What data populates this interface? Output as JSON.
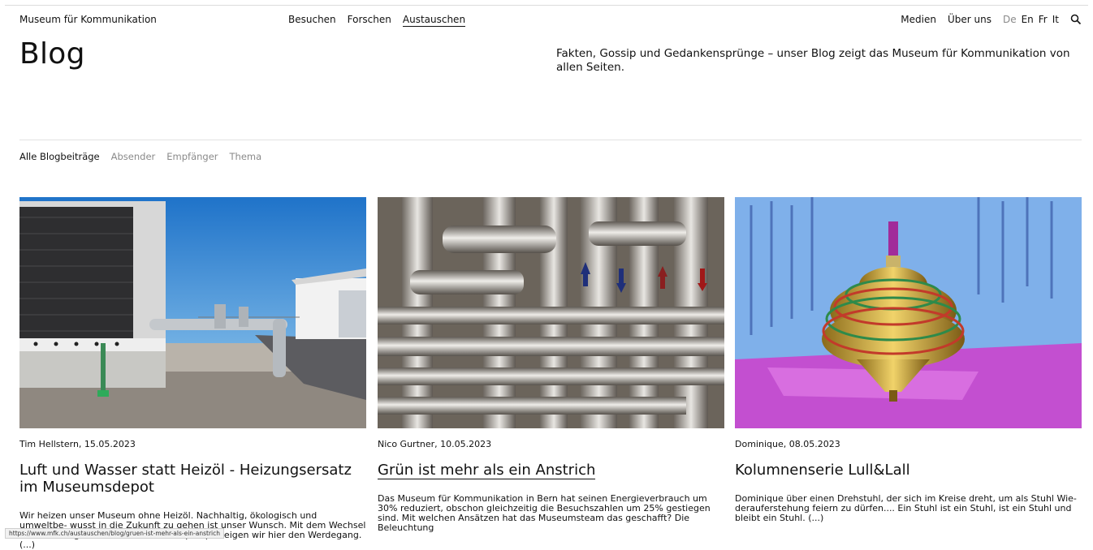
{
  "header": {
    "brand": "Museum für Kommunikation",
    "nav": [
      {
        "label": "Besuchen"
      },
      {
        "label": "Forschen"
      },
      {
        "label": "Austauschen"
      }
    ],
    "meta": {
      "medien": "Medien",
      "ueber_uns": "Über uns",
      "languages": [
        "De",
        "En",
        "Fr",
        "It"
      ],
      "search_icon": "search-icon"
    }
  },
  "page": {
    "title": "Blog",
    "intro": "Fakten, Gossip und Gedankensprünge – unser Blog zeigt das Museum für Kommunikation von allen Seiten."
  },
  "filters": [
    "Alle Blogbeiträge",
    "Absender",
    "Empfänger",
    "Thema"
  ],
  "posts": [
    {
      "byline": "Tim Hellstern, 15.05.2023",
      "title": "Luft und Wasser statt Heizöl - Heizungsersatz im Museumsdepot",
      "excerpt": "Wir heizen unser Museum ohne Heizöl. Nachhaltig, ökologisch und umweltbe- wusst in die Zukunft zu gehen ist unser Wunsch. Mit dem Wechsel der Hei- zung auf Luft-Wasser-Wärmepumpe zeigen wir hier den Werdegang. (...)"
    },
    {
      "byline": "Nico Gurtner, 10.05.2023",
      "title": "Grün ist mehr als ein Anstrich",
      "excerpt": "Das Museum für Kommunikation in Bern hat seinen Energieverbrauch um 30% reduziert, obschon gleichzeitig die Besuchszahlen um 25% gestiegen sind. Mit welchen Ansätzen hat das Museumsteam das geschafft? Die Beleuchtung"
    },
    {
      "byline": "Dominique, 08.05.2023",
      "title": "Kolumnenserie Lull&Lall",
      "excerpt": "Dominique über einen Drehstuhl, der sich im Kreise dreht, um als Stuhl Wie- derauferstehung feiern zu dürfen.... Ein Stuhl ist ein Stuhl, ist ein Stuhl und bleibt ein Stuhl. (...)"
    }
  ],
  "status_bar": {
    "url": "https://www.mfk.ch/austauschen/blog/gruen-ist-mehr-als-ein-anstrich"
  }
}
